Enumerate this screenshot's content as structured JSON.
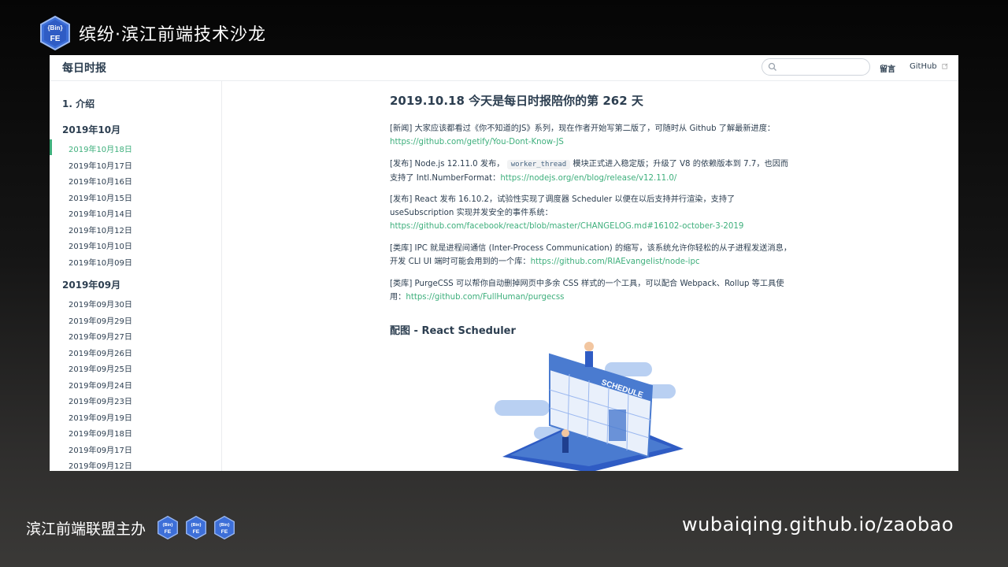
{
  "slide": {
    "title": "缤纷·滨江前端技术沙龙",
    "logo_text": "{Bin}",
    "logo_sub": "FE",
    "footer_left": "滨江前端联盟主办",
    "footer_right": "wubaiqing.github.io/zaobao"
  },
  "header": {
    "site_title": "每日时报",
    "search_placeholder": "",
    "nav_message": "留言",
    "nav_github": "GitHub"
  },
  "sidebar": {
    "intro": "1. 介绍",
    "groups": [
      {
        "label": "2019年10月",
        "items": [
          "2019年10月18日",
          "2019年10月17日",
          "2019年10月16日",
          "2019年10月15日",
          "2019年10月14日",
          "2019年10月12日",
          "2019年10月10日",
          "2019年10月09日"
        ]
      },
      {
        "label": "2019年09月",
        "items": [
          "2019年09月30日",
          "2019年09月29日",
          "2019年09月27日",
          "2019年09月26日",
          "2019年09月25日",
          "2019年09月24日",
          "2019年09月23日",
          "2019年09月19日",
          "2019年09月18日",
          "2019年09月17日",
          "2019年09月12日"
        ]
      }
    ]
  },
  "content": {
    "title": "2019.10.18 今天是每日时报陪你的第 262 天",
    "p1_text": "[新闻] 大家应该都看过《你不知道的JS》系列，现在作者开始写第二版了，可随时从 Github 了解最新进度：",
    "p1_link": "https://github.com/getify/You-Dont-Know-JS",
    "p2_text_a": "[发布] Node.js 12.11.0 发布，",
    "p2_code": "worker_thread",
    "p2_text_b": " 模块正式进入稳定版；升级了 V8 的依赖版本到 7.7，也因而支持了 Intl.NumberFormat：",
    "p2_link": "https://nodejs.org/en/blog/release/v12.11.0/",
    "p3_text": "[发布] React 发布 16.10.2，试验性实现了调度器 Scheduler 以便在以后支持并行渲染，支持了 useSubscription 实现并发安全的事件系统：",
    "p3_link": "https://github.com/facebook/react/blob/master/CHANGELOG.md#16102-october-3-2019",
    "p4_text": "[类库] IPC 就是进程间通信 (Inter-Process Communication) 的缩写，该系统允许你轻松的从子进程发送消息，开发 CLI UI 端时可能会用到的一个库：",
    "p4_link": "https://github.com/RIAEvangelist/node-ipc",
    "p5_text": "[类库] PurgeCSS 可以帮你自动删掉网页中多余 CSS 样式的一个工具，可以配合 Webpack、Rollup 等工具使用：",
    "p5_link": "https://github.com/FullHuman/purgecss",
    "h2": "配图 - React Scheduler",
    "illus_label": "SCHEDULE"
  },
  "colors": {
    "accent": "#3eaf7c",
    "text": "#2c3e50",
    "illus_blue": "#4a7bd0"
  }
}
